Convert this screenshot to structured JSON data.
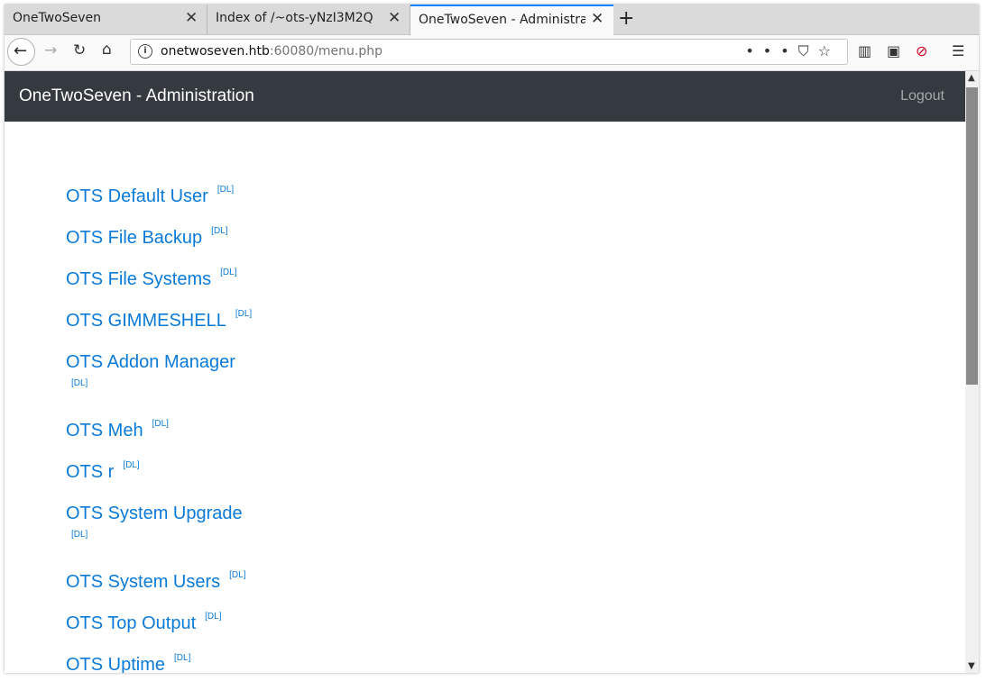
{
  "browser": {
    "tabs": [
      {
        "title": "OneTwoSeven",
        "active": false
      },
      {
        "title": "Index of /~ots-yNzI3M2Q",
        "active": false
      },
      {
        "title": "OneTwoSeven - Administrati",
        "active": true
      }
    ],
    "url_host": "onetwoseven.htb",
    "url_path": ":60080/menu.php",
    "new_tab_symbol": "+",
    "icons": [
      "back-icon",
      "forward-icon",
      "reload-icon",
      "home-icon",
      "info-icon",
      "more-icon",
      "pocket-icon",
      "bookmark-star-icon",
      "library-icon",
      "sidebar-icon",
      "addon-icon",
      "menu-icon"
    ]
  },
  "app": {
    "brand": "OneTwoSeven - Administration",
    "logout": "Logout",
    "dl_label": "[DL]",
    "menu": [
      "OTS Default User",
      "OTS File Backup",
      "OTS File Systems",
      "OTS GIMMESHELL",
      "OTS Addon Manager",
      "OTS Meh",
      "OTS r",
      "OTS System Upgrade",
      "OTS System Users",
      "OTS Top Output",
      "OTS Uptime"
    ]
  },
  "colors": {
    "navbar_bg": "#343a40",
    "link": "#0a7ad9",
    "active_tab_accent": "#0a84ff"
  }
}
